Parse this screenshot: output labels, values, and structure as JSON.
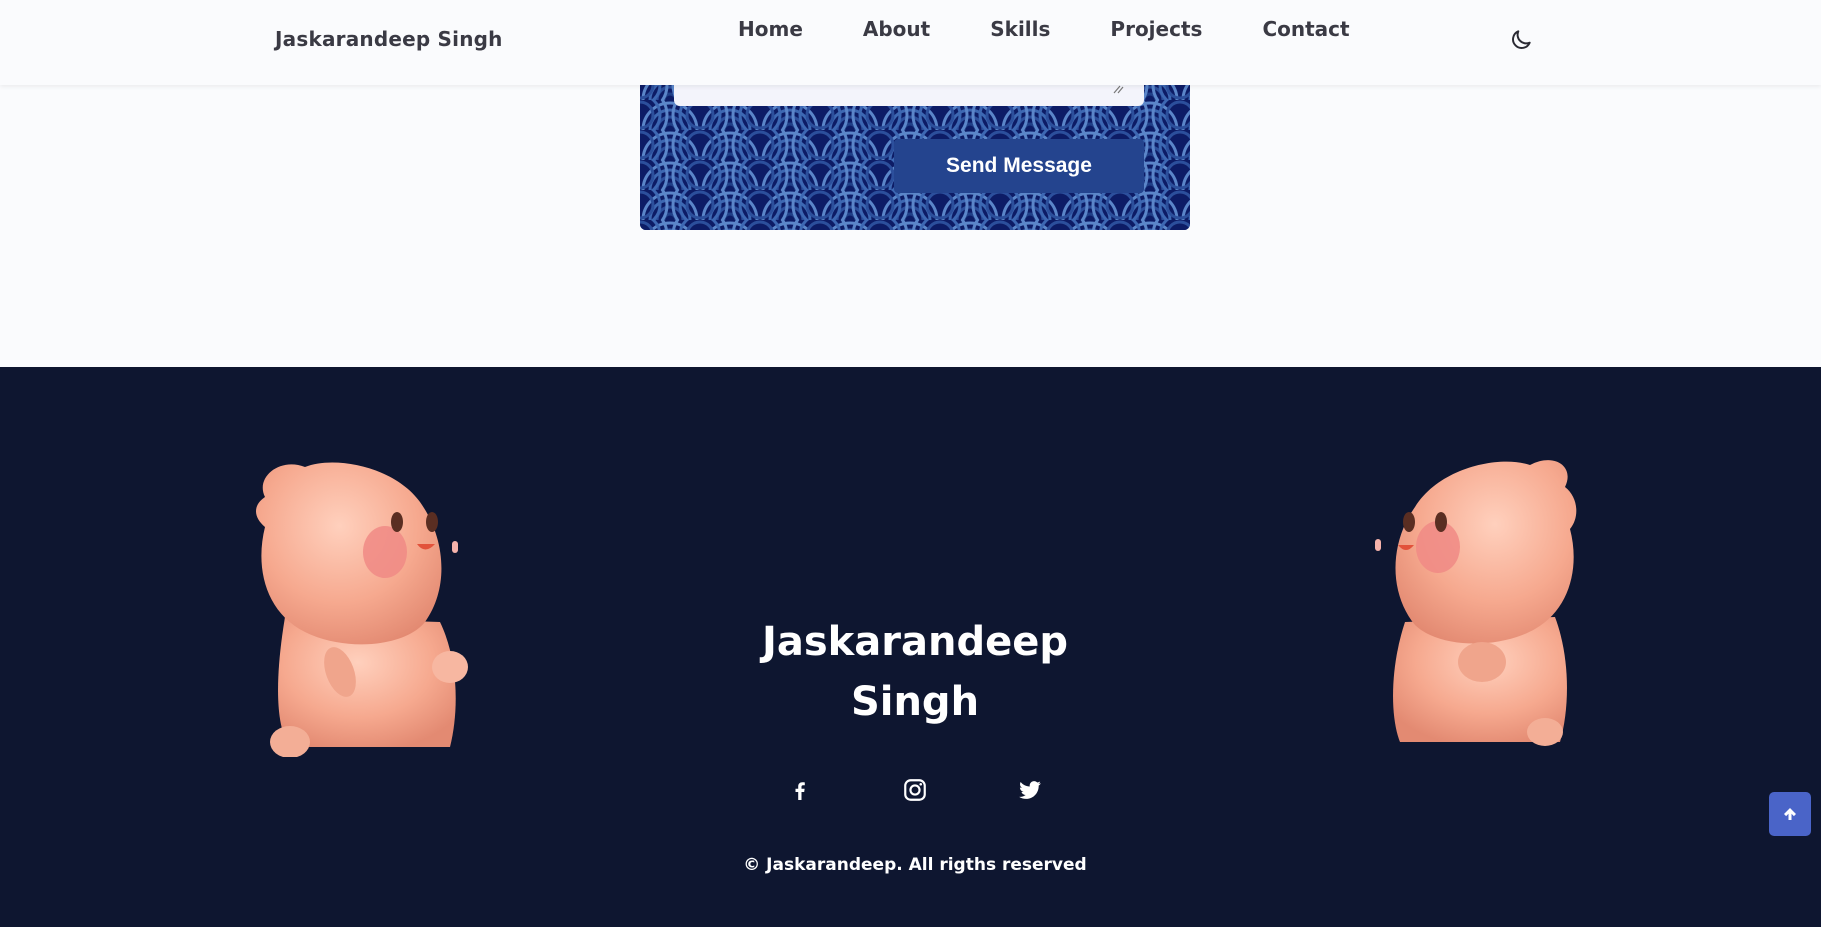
{
  "header": {
    "brand": "Jaskarandeep Singh",
    "nav": [
      "Home",
      "About",
      "Skills",
      "Projects",
      "Contact"
    ],
    "theme_icon": "moon-icon"
  },
  "contact": {
    "send_label": "Send Message",
    "accent": "#24448e"
  },
  "footer": {
    "name_line1": "Jaskarandeep",
    "name_line2": "Singh",
    "socials": [
      "facebook-icon",
      "instagram-icon",
      "twitter-icon"
    ],
    "copyright": "© Jaskarandeep. All rigths reserved",
    "background": "#0e1630"
  },
  "scroll_top_icon": "arrow-up-icon"
}
